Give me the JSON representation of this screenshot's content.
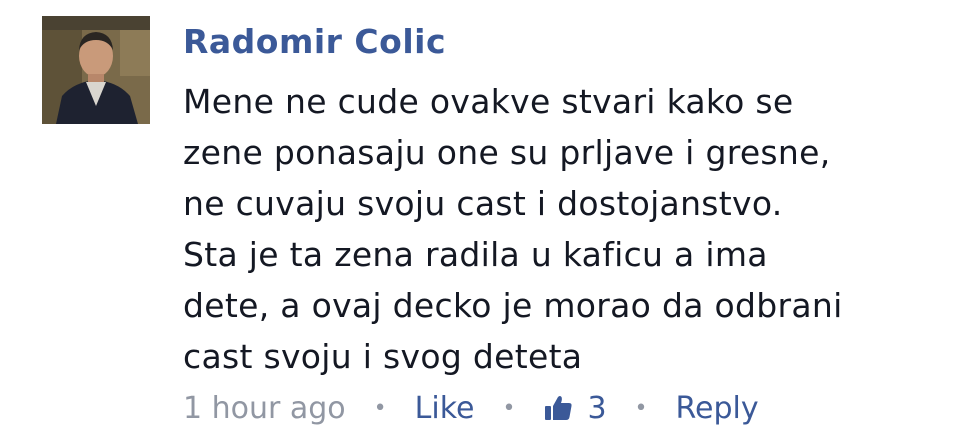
{
  "comment": {
    "author": "Radomir Colic",
    "lines": [
      "Mene ne cude ovakve stvari kako se",
      "zene ponasaju one su prljave i gresne,",
      "ne cuvaju svoju cast i dostojanstvo.",
      "Sta je ta zena radila u kaficu a ima",
      "dete, a ovaj decko je morao da odbrani",
      "cast svoju i svog deteta"
    ],
    "timestamp": "1 hour ago",
    "separator": "•",
    "like_label": "Like",
    "like_count": "3",
    "reply_label": "Reply",
    "like_icon": "thumbs-up-icon"
  },
  "colors": {
    "author": "#3b5998",
    "text": "#141823",
    "meta": "#9197a3",
    "link": "#3b5998"
  }
}
